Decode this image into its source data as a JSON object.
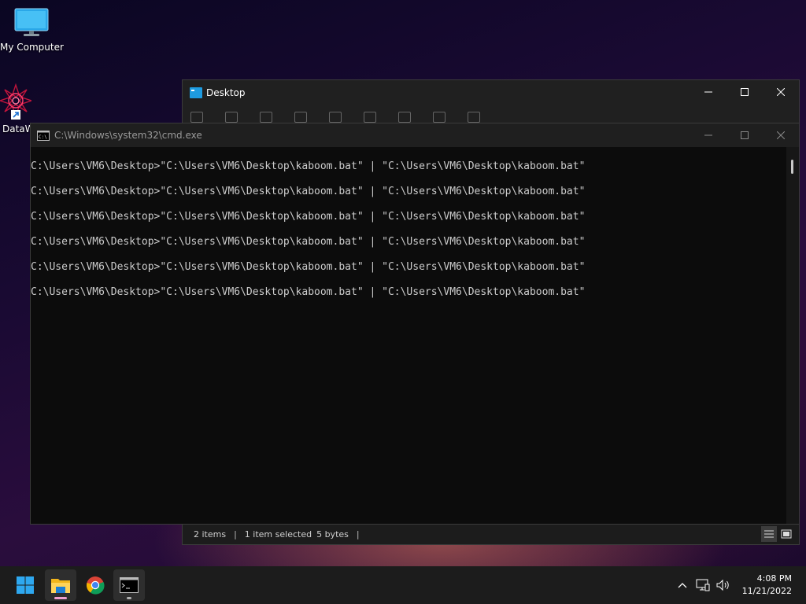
{
  "desktop": {
    "icons": [
      {
        "label": "My Computer",
        "icon": "monitor-icon"
      },
      {
        "label": "DataW",
        "icon": "shortcut-app-icon"
      }
    ]
  },
  "explorer": {
    "title": "Desktop",
    "status": {
      "items": "2 items",
      "selected": "1 item selected",
      "size": "5 bytes"
    }
  },
  "cmd": {
    "title": "C:\\Windows\\system32\\cmd.exe",
    "lines": [
      "C:\\Users\\VM6\\Desktop>\"C:\\Users\\VM6\\Desktop\\kaboom.bat\" | \"C:\\Users\\VM6\\Desktop\\kaboom.bat\"",
      "C:\\Users\\VM6\\Desktop>\"C:\\Users\\VM6\\Desktop\\kaboom.bat\" | \"C:\\Users\\VM6\\Desktop\\kaboom.bat\"",
      "C:\\Users\\VM6\\Desktop>\"C:\\Users\\VM6\\Desktop\\kaboom.bat\" | \"C:\\Users\\VM6\\Desktop\\kaboom.bat\"",
      "C:\\Users\\VM6\\Desktop>\"C:\\Users\\VM6\\Desktop\\kaboom.bat\" | \"C:\\Users\\VM6\\Desktop\\kaboom.bat\"",
      "C:\\Users\\VM6\\Desktop>\"C:\\Users\\VM6\\Desktop\\kaboom.bat\" | \"C:\\Users\\VM6\\Desktop\\kaboom.bat\"",
      "C:\\Users\\VM6\\Desktop>\"C:\\Users\\VM6\\Desktop\\kaboom.bat\" | \"C:\\Users\\VM6\\Desktop\\kaboom.bat\""
    ]
  },
  "taskbar": {
    "apps": [
      "start-icon",
      "file-explorer-icon",
      "chrome-icon",
      "cmd-icon"
    ],
    "clock": {
      "time": "4:08 PM",
      "date": "11/21/2022"
    }
  },
  "colors": {
    "accent": "#0078d4",
    "explorer_indicator": "#f0a0d0",
    "cmd_text": "#cccccc"
  }
}
